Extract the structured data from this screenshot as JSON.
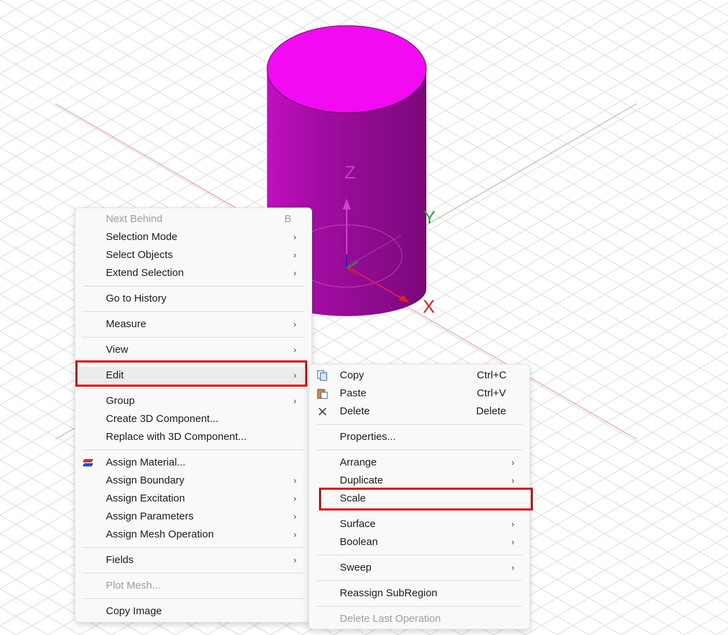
{
  "viewport": {
    "axis_labels": {
      "z": "Z",
      "y": "Y",
      "x": "X"
    },
    "colors": {
      "cylinder_top": "#f20af2",
      "cylinder_side": "#9a0a9a",
      "x_axis": "#e02020",
      "y_axis": "#30a030",
      "z_axis": "#b030c0"
    }
  },
  "context_menu": {
    "items": [
      {
        "label": "Next Behind",
        "shortcut": "B",
        "disabled": true
      },
      {
        "label": "Selection Mode"
      },
      {
        "label": "Select Objects"
      },
      {
        "label": "Extend Selection"
      },
      {
        "label": "Go to History"
      },
      {
        "label": "Measure"
      },
      {
        "label": "View"
      },
      {
        "label": "Edit"
      },
      {
        "label": "Group"
      },
      {
        "label": "Create 3D Component..."
      },
      {
        "label": "Replace with 3D Component..."
      },
      {
        "label": "Assign Material...",
        "icon": "material-icon"
      },
      {
        "label": "Assign Boundary"
      },
      {
        "label": "Assign Excitation"
      },
      {
        "label": "Assign Parameters"
      },
      {
        "label": "Assign Mesh Operation"
      },
      {
        "label": "Fields"
      },
      {
        "label": "Plot Mesh...",
        "disabled": true
      },
      {
        "label": "Copy Image"
      }
    ]
  },
  "edit_submenu": {
    "items": [
      {
        "label": "Copy",
        "shortcut": "Ctrl+C",
        "icon": "copy-icon"
      },
      {
        "label": "Paste",
        "shortcut": "Ctrl+V",
        "icon": "paste-icon"
      },
      {
        "label": "Delete",
        "shortcut": "Delete",
        "icon": "delete-icon"
      },
      {
        "label": "Properties..."
      },
      {
        "label": "Arrange"
      },
      {
        "label": "Duplicate"
      },
      {
        "label": "Scale"
      },
      {
        "label": "Surface"
      },
      {
        "label": "Boolean"
      },
      {
        "label": "Sweep"
      },
      {
        "label": "Reassign SubRegion"
      },
      {
        "label": "Delete Last Operation",
        "disabled": true
      }
    ]
  },
  "highlight_color": "#e00000",
  "arrow_glyph": "›"
}
